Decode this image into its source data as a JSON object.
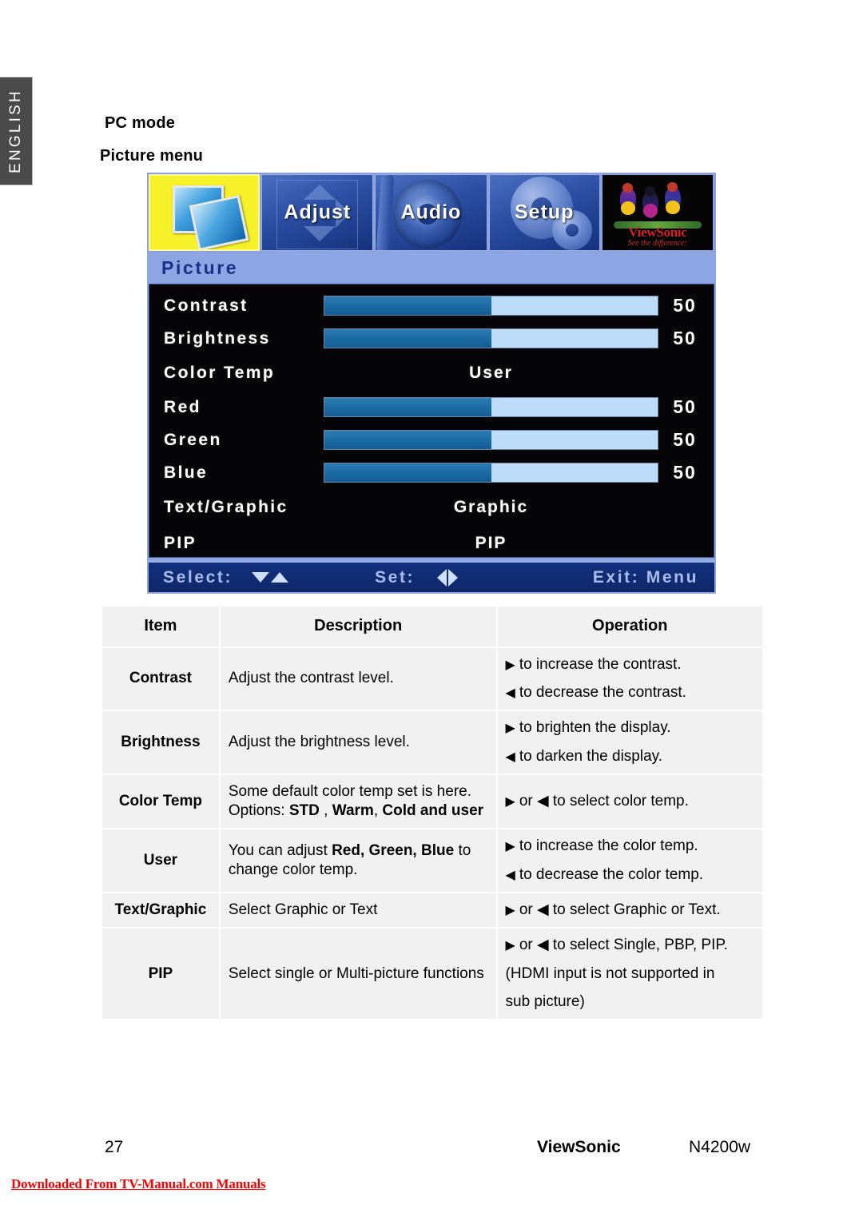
{
  "sidebar": {
    "language_tab": "ENGLISH"
  },
  "headings": {
    "mode": "PC mode",
    "menu": "Picture menu"
  },
  "osd": {
    "tabs": [
      {
        "name": "picture",
        "label": "",
        "icon": "picture-frames-icon",
        "selected": true
      },
      {
        "name": "adjust",
        "label": "Adjust",
        "icon": "adjust-arrows-icon",
        "selected": false
      },
      {
        "name": "audio",
        "label": "Audio",
        "icon": "speaker-icon",
        "selected": false
      },
      {
        "name": "setup",
        "label": "Setup",
        "icon": "gear-icon",
        "selected": false
      },
      {
        "name": "logo",
        "label": "",
        "icon": "viewsonic-birds-logo",
        "selected": false
      }
    ],
    "title": "Picture",
    "logo": {
      "word": "ViewSonic",
      "tagline": "See the difference:"
    },
    "rows": [
      {
        "label": "Contrast",
        "type": "slider",
        "value": "50",
        "percent": 50
      },
      {
        "label": "Brightness",
        "type": "slider",
        "value": "50",
        "percent": 50
      },
      {
        "label": "Color Temp",
        "type": "option",
        "value": "User"
      },
      {
        "label": "Red",
        "type": "slider",
        "value": "50",
        "percent": 50
      },
      {
        "label": "Green",
        "type": "slider",
        "value": "50",
        "percent": 50
      },
      {
        "label": "Blue",
        "type": "slider",
        "value": "50",
        "percent": 50
      },
      {
        "label": "Text/Graphic",
        "type": "option",
        "value": "Graphic"
      },
      {
        "label": "PIP",
        "type": "option",
        "value": "PIP"
      }
    ],
    "footer": {
      "select_label": "Select:",
      "set_label": "Set:",
      "exit_label": "Exit: Menu"
    },
    "colors": {
      "highlight_yellow": "#f7f12a",
      "title_bar_blue": "#8ea5e4",
      "slider_fill": "#1b6ba4",
      "slider_track": "#bcdcf8",
      "footer_blue": "#12307e"
    }
  },
  "table": {
    "headers": [
      "Item",
      "Description",
      "Operation"
    ],
    "rows": [
      {
        "item": "Contrast",
        "description": "Adjust the contrast level.",
        "operations": [
          {
            "arrow": "right",
            "text": "to increase the contrast."
          },
          {
            "arrow": "left",
            "text": "to decrease the contrast."
          }
        ]
      },
      {
        "item": "Brightness",
        "description": "Adjust the brightness level.",
        "operations": [
          {
            "arrow": "right",
            "text": "to brighten the display."
          },
          {
            "arrow": "left",
            "text": "to darken the display."
          }
        ]
      },
      {
        "item": "Color Temp",
        "description_html": "Some default color temp set is here. Options: <b>STD</b> , <b>Warm</b>, <b>Cold and user</b>",
        "description": "Some default color temp set is here. Options: STD , Warm, Cold and user",
        "operations": [
          {
            "arrow": "right",
            "text": "or ◀ to select color temp."
          }
        ]
      },
      {
        "item": "User",
        "description_html": "You can adjust <b>Red, Green, Blue</b> to change color temp.",
        "description": "You can adjust Red, Green, Blue to change color temp.",
        "operations": [
          {
            "arrow": "right",
            "text": "to increase the color temp."
          },
          {
            "arrow": "left",
            "text": "to decrease the color temp."
          }
        ]
      },
      {
        "item": "Text/Graphic",
        "description": "Select Graphic or Text",
        "operations": [
          {
            "arrow": "right",
            "text": "or ◀ to select Graphic or Text."
          }
        ]
      },
      {
        "item": "PIP",
        "description": "Select single or Multi-picture functions",
        "operations": [
          {
            "arrow": "right",
            "text": "or ◀ to select Single, PBP, PIP."
          },
          {
            "arrow": "none",
            "text": "(HDMI input is not supported in"
          },
          {
            "arrow": "none",
            "text": "sub picture)"
          }
        ]
      }
    ]
  },
  "footer": {
    "page_number": "27",
    "brand": "ViewSonic",
    "model": "N4200w",
    "download_note": "Downloaded From TV-Manual.com Manuals"
  }
}
